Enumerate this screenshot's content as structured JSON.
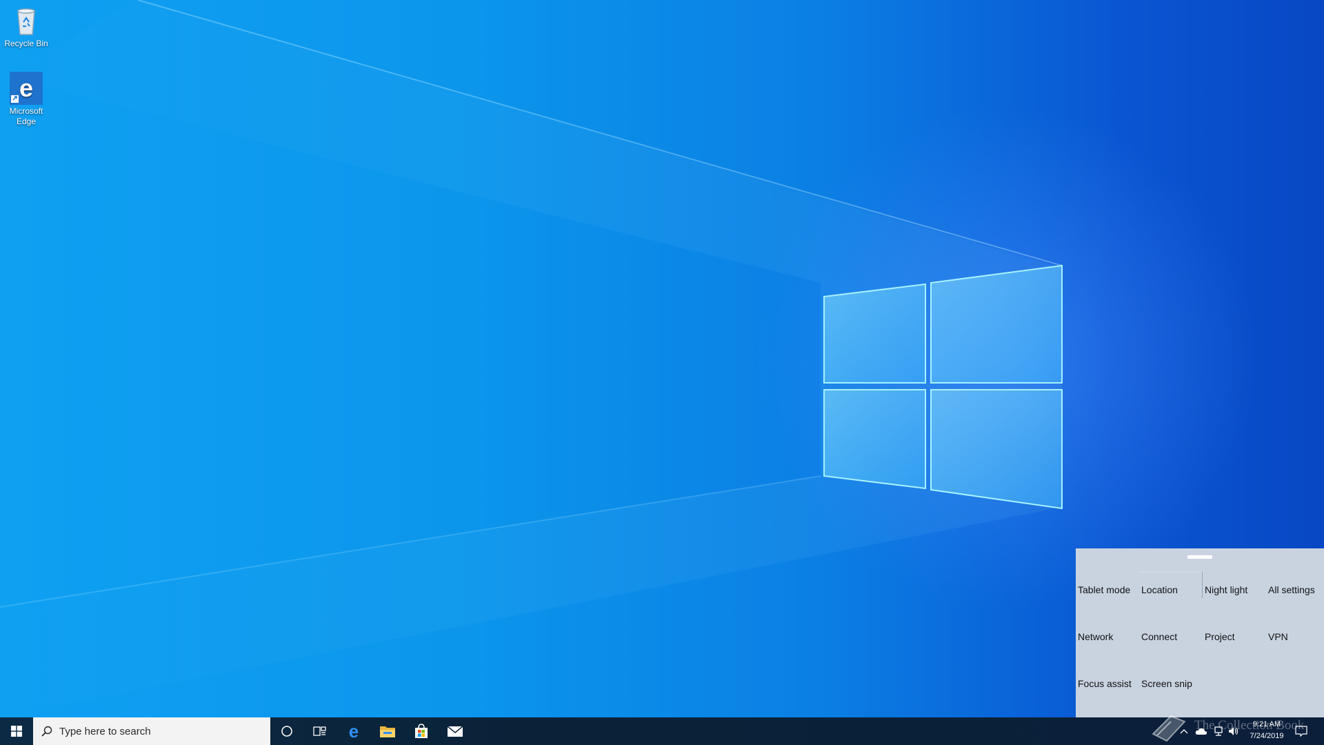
{
  "desktop": {
    "icons": [
      {
        "label": "Recycle Bin",
        "icon": "recycle-bin-icon"
      },
      {
        "label": "Microsoft Edge",
        "icon": "edge-icon"
      }
    ]
  },
  "taskbar": {
    "search": {
      "placeholder": "Type here to search",
      "icon": "search-icon"
    },
    "pinned": [
      {
        "name": "Cortana",
        "icon": "cortana-circle-icon"
      },
      {
        "name": "Task View",
        "icon": "task-view-icon"
      },
      {
        "name": "Microsoft Edge",
        "icon": "edge-icon"
      },
      {
        "name": "File Explorer",
        "icon": "folder-icon"
      },
      {
        "name": "Microsoft Store",
        "icon": "store-bag-icon"
      },
      {
        "name": "Mail",
        "icon": "mail-icon"
      }
    ],
    "tray": {
      "time": "9:21 AM",
      "date": "7/24/2019"
    }
  },
  "quick_actions": {
    "tiles": [
      {
        "label": "Tablet mode"
      },
      {
        "label": "Location"
      },
      {
        "label": "Night light"
      },
      {
        "label": "All settings"
      },
      {
        "label": "Network"
      },
      {
        "label": "Connect"
      },
      {
        "label": "Project"
      },
      {
        "label": "VPN"
      },
      {
        "label": "Focus assist"
      },
      {
        "label": "Screen snip"
      }
    ]
  },
  "watermark": {
    "text": "The Collection Book"
  },
  "colors": {
    "wallpaper_light": "#0fa0f2",
    "wallpaper_dark": "#0847c4",
    "taskbar": "#0a2238",
    "panel": "#c9d3e0",
    "edge_blue": "#1e7bd7"
  }
}
